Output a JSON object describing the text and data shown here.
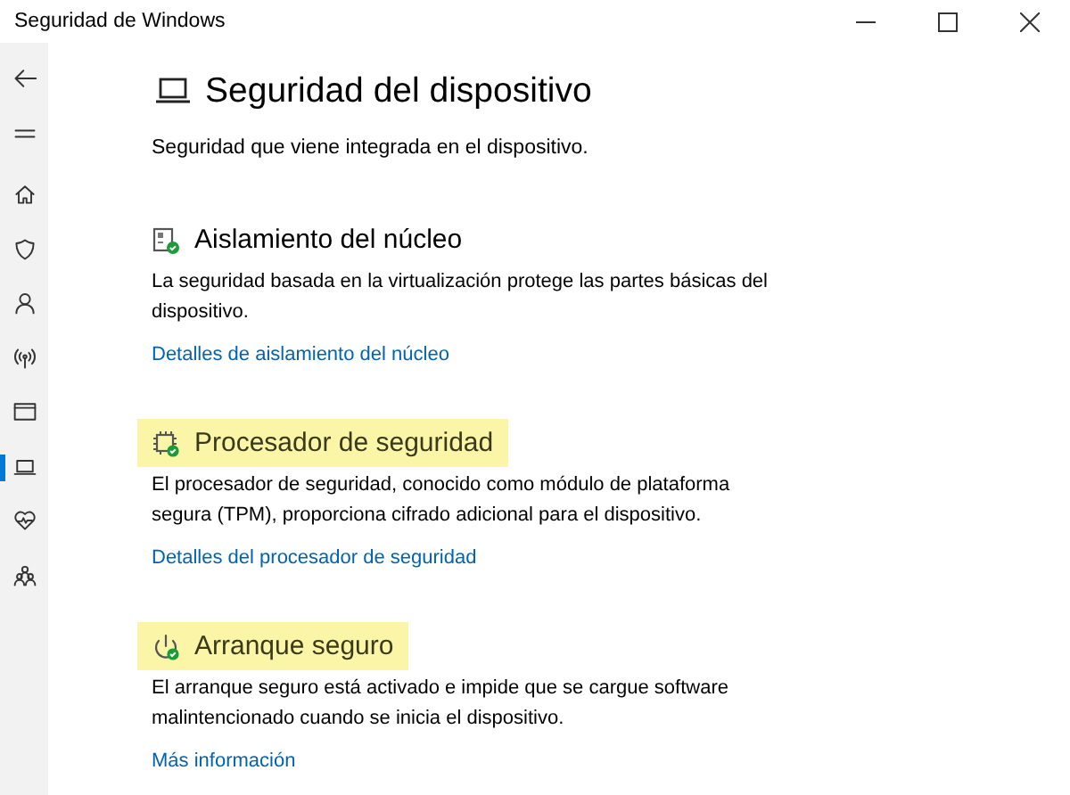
{
  "window": {
    "title": "Seguridad de Windows"
  },
  "sidebar": {
    "items": [
      {
        "kind": "back",
        "selected": false
      },
      {
        "kind": "menu",
        "selected": false
      },
      {
        "kind": "home",
        "selected": false
      },
      {
        "kind": "shield",
        "selected": false
      },
      {
        "kind": "person",
        "selected": false
      },
      {
        "kind": "antenna",
        "selected": false
      },
      {
        "kind": "browser",
        "selected": false
      },
      {
        "kind": "laptop",
        "selected": true
      },
      {
        "kind": "heart",
        "selected": false
      },
      {
        "kind": "family",
        "selected": false
      }
    ]
  },
  "page": {
    "title": "Seguridad del dispositivo",
    "subtitle": "Seguridad que viene integrada en el dispositivo."
  },
  "sections": [
    {
      "kind": "isolation",
      "title": "Aislamiento del núcleo",
      "highlighted": false,
      "description": "La seguridad basada en la virtualización protege las partes básicas del dispositivo.",
      "link": "Detalles de aislamiento del núcleo"
    },
    {
      "kind": "processor",
      "title": "Procesador de seguridad",
      "highlighted": true,
      "description": "El procesador de seguridad, conocido como módulo de plataforma segura (TPM), proporciona cifrado adicional para el dispositivo.",
      "link": "Detalles del procesador de seguridad"
    },
    {
      "kind": "boot",
      "title": "Arranque seguro",
      "highlighted": true,
      "description": "El arranque seguro está activado e impide que se cargue software malintencionado cuando se inicia el dispositivo.",
      "link": "Más información"
    }
  ]
}
